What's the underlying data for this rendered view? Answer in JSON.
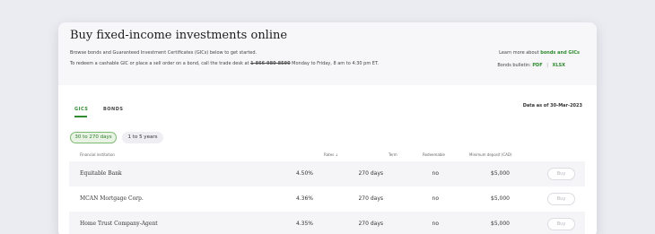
{
  "header": {
    "title": "Buy fixed-income investments online",
    "subtitle": "Browse bonds and Guaranteed Investment Certificates (GICs) below to get started.",
    "redeem_prefix": "To redeem a cashable GIC or place a sell order on a bond, call the trade desk at",
    "redeem_phone": "1-866-980-8590",
    "redeem_suffix": "Monday to Friday, 8 am to 4:30 pm ET.",
    "learn_prefix": "Learn more about",
    "learn_link": "bonds and GICs",
    "bulletin_label": "Bonds bulletin:",
    "bulletin_pdf": "PDF",
    "bulletin_sep": "|",
    "bulletin_xlsx": "XLSX"
  },
  "tabs": [
    {
      "label": "GICS",
      "active": true
    },
    {
      "label": "BONDS",
      "active": false
    }
  ],
  "data_as_of": "Data as of 30-Mar-2023",
  "filters": [
    {
      "label": "30 to 270 days",
      "active": true
    },
    {
      "label": "1 to 5 years",
      "active": false
    }
  ],
  "table": {
    "columns": {
      "institution": "Financial institution",
      "rates": "Rates",
      "rates_sort_icon": "↓",
      "term": "Term",
      "redeemable": "Redeemable",
      "min_deposit": "Minimum deposit (CAD)"
    },
    "rows": [
      {
        "institution": "Equitable Bank",
        "rate": "4.50%",
        "term": "270 days",
        "redeemable": "no",
        "min_deposit": "$5,000",
        "action": "Buy"
      },
      {
        "institution": "MCAN Mortgage Corp.",
        "rate": "4.36%",
        "term": "270 days",
        "redeemable": "no",
        "min_deposit": "$5,000",
        "action": "Buy"
      },
      {
        "institution": "Home Trust Company-Agent",
        "rate": "4.35%",
        "term": "270 days",
        "redeemable": "no",
        "min_deposit": "$5,000",
        "action": "Buy"
      }
    ]
  },
  "colors": {
    "accent_green": "#2e8b2e",
    "page_background": "#ebebf2",
    "header_background": "#f7f7f9"
  }
}
